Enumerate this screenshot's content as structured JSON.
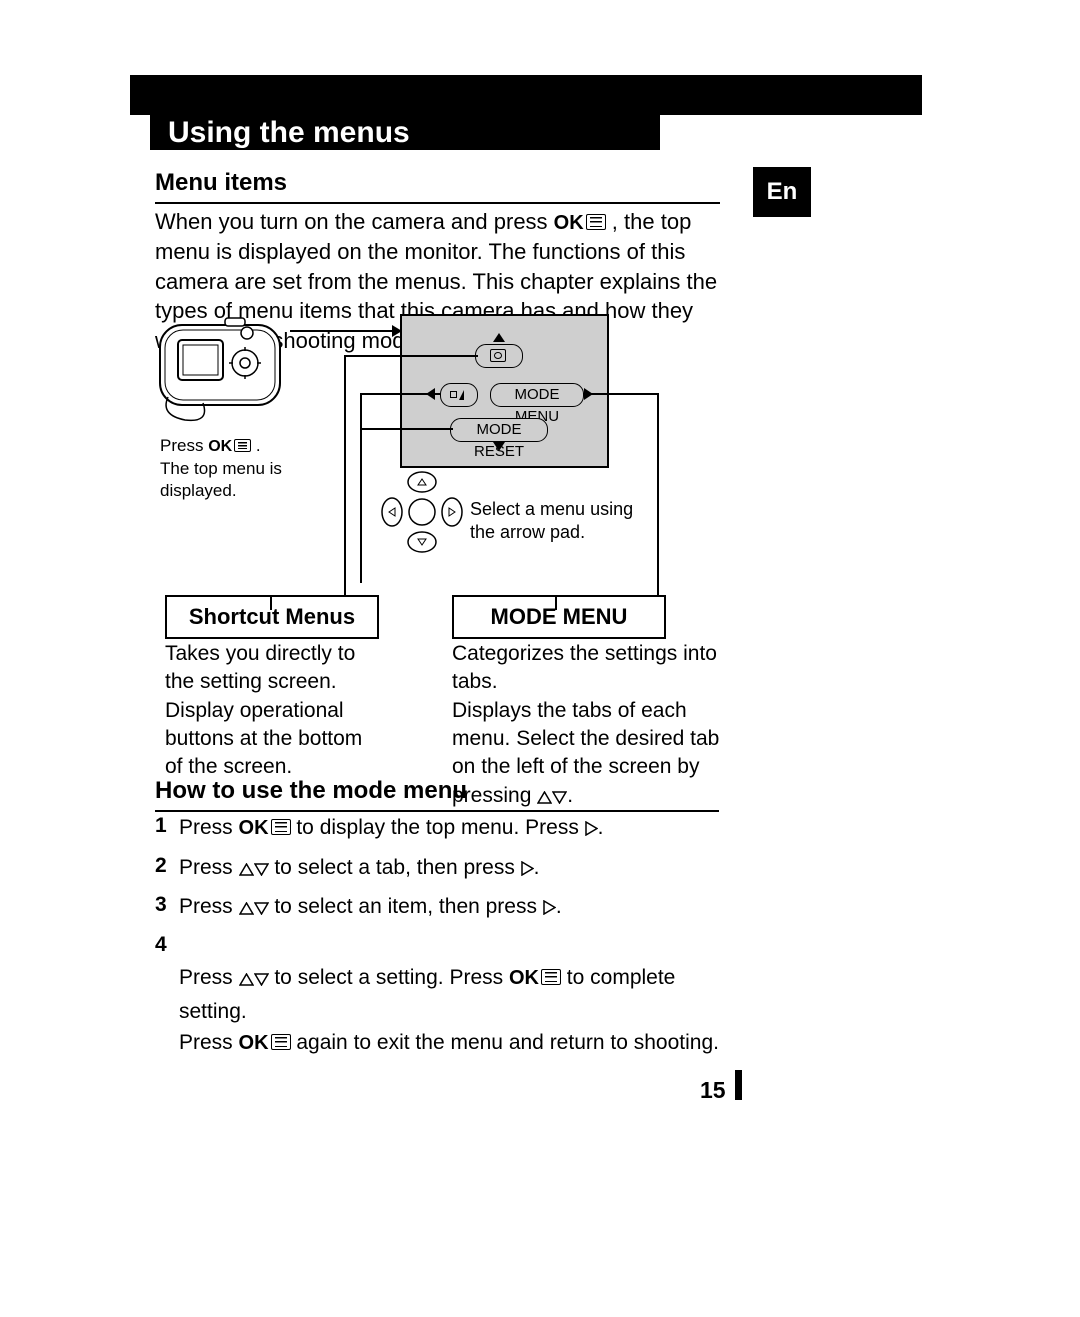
{
  "title": "Using the menus",
  "lang_tab": "En",
  "page_number": "15",
  "section_menu_items": "Menu items",
  "intro_pre": "When you turn on the camera and press ",
  "ok_label": "OK",
  "intro_post": ", the top menu is displayed on the monitor. The functions of this camera are set from the menus. This chapter explains the types of menu items that this camera has and how they work, using shooting mode screens.",
  "camera_caption_pre": "Press ",
  "camera_caption_post": ".\nThe top menu is displayed.",
  "arrowpad_caption": "Select a menu using the arrow pad.",
  "screen_mode_menu": "MODE MENU",
  "screen_mode_reset": "MODE RESET",
  "shortcut_title": "Shortcut Menus",
  "shortcut_desc": "Takes you directly to the setting screen.\nDisplay operational buttons at the bottom of the screen.",
  "modemenu_title": "MODE MENU",
  "modemenu_desc_1": "Categorizes the settings into tabs.",
  "modemenu_desc_2": "Displays the tabs of each menu. Select the desired tab on the left of the screen by pressing ",
  "modemenu_desc_3": ".",
  "section_howto": "How to use the mode menu",
  "steps": [
    {
      "num": "1",
      "pre": "Press ",
      "ok": true,
      "mid": " to display the top menu. Press ",
      "arrows": "r",
      "post": "."
    },
    {
      "num": "2",
      "pre": "Press ",
      "arrows": "ud",
      "mid": " to select a tab, then press ",
      "arrows2": "r",
      "post": "."
    },
    {
      "num": "3",
      "pre": "Press ",
      "arrows": "ud",
      "mid": " to select an item, then press ",
      "arrows2": "r",
      "post": "."
    },
    {
      "num": "4",
      "pre": "Press  ",
      "arrows": "ud",
      "mid": " to select a setting. Press ",
      "ok2": true,
      "mid2": " to complete setting.\nPress ",
      "ok3": true,
      "post": " again to exit the menu and return to shooting."
    }
  ]
}
